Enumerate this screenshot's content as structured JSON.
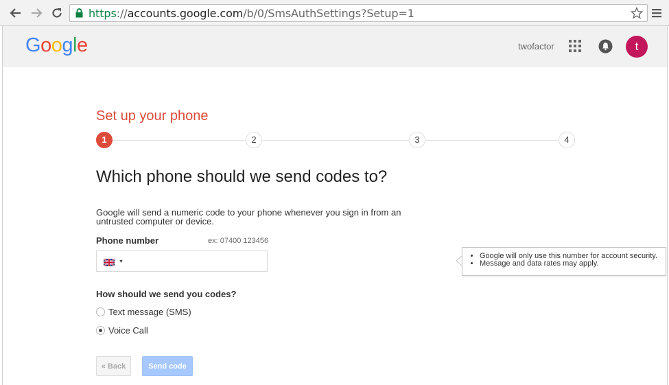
{
  "browser": {
    "url_secure": "https",
    "url_sep": "://",
    "url_host": "accounts.google.com",
    "url_path": "/b/0/SmsAuthSettings?Setup=1"
  },
  "header": {
    "logo": [
      "G",
      "o",
      "o",
      "g",
      "l",
      "e"
    ],
    "logo_colors": [
      "#4285f4",
      "#ea4335",
      "#fbbc05",
      "#4285f4",
      "#34a853",
      "#ea4335"
    ],
    "account_name": "twofactor",
    "avatar_letter": "t",
    "avatar_color": "#c2185b"
  },
  "wizard": {
    "title": "Set up your phone",
    "steps": [
      "1",
      "2",
      "3",
      "4"
    ],
    "active_step": 1,
    "accent_color": "#dd4b39"
  },
  "main": {
    "question": "Which phone should we send codes to?",
    "description": "Google will send a numeric code to your phone whenever you sign in from an untrusted computer or device.",
    "phone_label": "Phone number",
    "phone_example": "ex: 07400 123456",
    "phone_value": "",
    "country_icon": "uk-flag-icon",
    "method_label": "How should we send you codes?",
    "methods": [
      {
        "label": "Text message (SMS)",
        "checked": false
      },
      {
        "label": "Voice Call",
        "checked": true
      }
    ],
    "back_label": "« Back",
    "send_label": "Send code"
  },
  "tooltip": {
    "items": [
      "Google will only use this number for account security.",
      "Message and data rates may apply."
    ]
  }
}
